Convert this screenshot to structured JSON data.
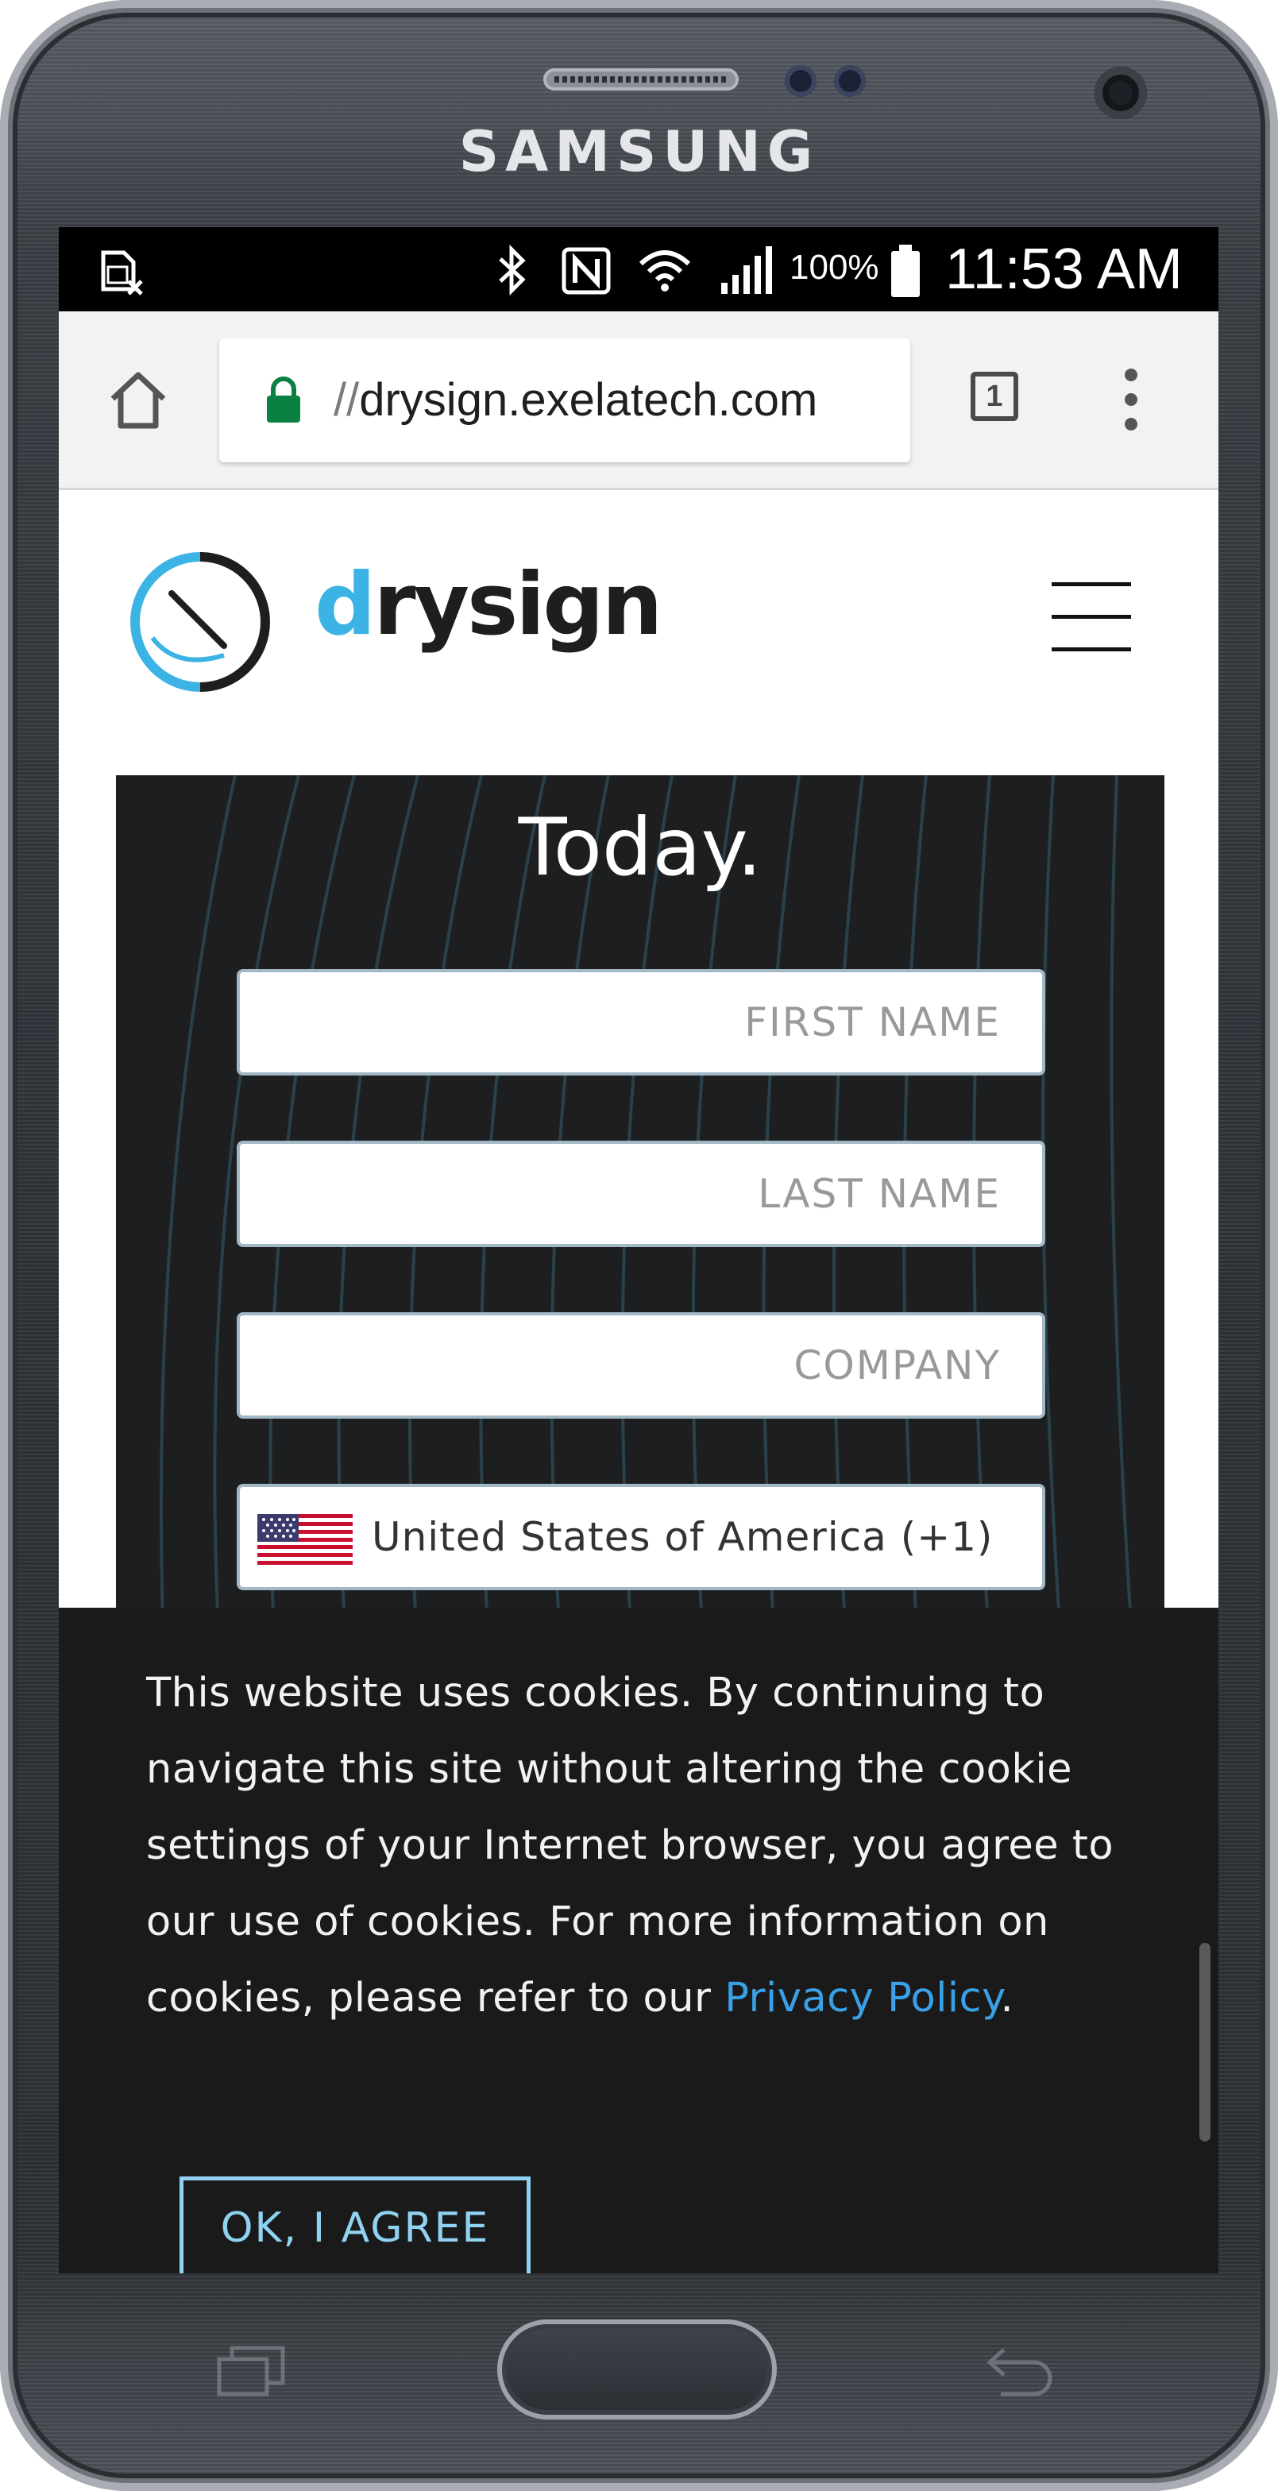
{
  "device": {
    "brand": "SAMSUNG"
  },
  "status_bar": {
    "battery": "100%",
    "time": "11:53 AM",
    "icons": [
      "sim-off-icon",
      "bluetooth-icon",
      "nfc-icon",
      "wifi-icon",
      "signal-icon",
      "battery-icon"
    ]
  },
  "browser": {
    "url_scheme": "//",
    "url_host": "drysign.exelatech.com",
    "tab_count": "1",
    "icons": [
      "home-icon",
      "lock-icon",
      "tab-switcher-icon",
      "overflow-menu-icon"
    ]
  },
  "site": {
    "logo_text_accent": "d",
    "logo_text_rest": "rysign",
    "menu_icon": "hamburger-menu-icon"
  },
  "form": {
    "heading": "Today.",
    "first_name_placeholder": "FIRST NAME",
    "last_name_placeholder": "LAST NAME",
    "company_placeholder": "COMPANY",
    "country_value": "United States of America (+1)",
    "country_flag": "us-flag-icon"
  },
  "cookie_banner": {
    "text": "This website uses cookies. By continuing to navigate this site without altering the cookie settings of your Internet browser, you agree to our use of cookies. For more information on cookies, please refer to our ",
    "link_text": "Privacy Policy",
    "text_end": ".",
    "button_label": "OK, I AGREE"
  },
  "colors": {
    "accent_blue": "#3bb4e5",
    "link_blue": "#3aa0e8",
    "panel_dark": "#1d1e1f",
    "button_border": "#8fd2f2"
  }
}
